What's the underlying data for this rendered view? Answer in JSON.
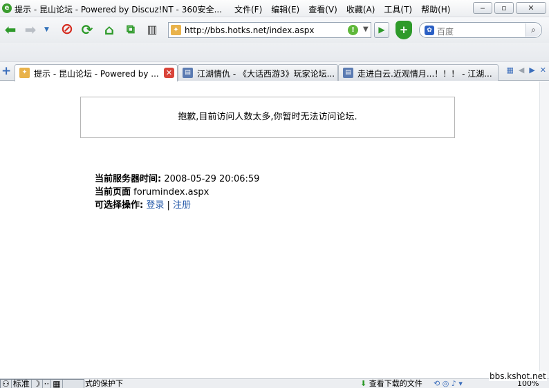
{
  "window": {
    "title": "提示 - 昆山论坛 - Powered by Discuz!NT - 360安全...",
    "menus": [
      "文件(F)",
      "编辑(E)",
      "查看(V)",
      "收藏(A)",
      "工具(T)",
      "帮助(H)"
    ],
    "controls": [
      "minimize-icon",
      "restore-icon",
      "close-icon"
    ]
  },
  "toolbar": {
    "url": "http://bbs.hotks.net/index.aspx",
    "search_placeholder": "百度"
  },
  "tabs": [
    {
      "label": "提示 - 昆山论坛 - Powered by ...",
      "active": true
    },
    {
      "label": "江湖情仇 - 《大话西游3》玩家论坛...",
      "active": false
    },
    {
      "label": "走进白云.近观情月...！！！ - 江湖...",
      "active": false
    }
  ],
  "page": {
    "message": "抱歉,目前访问人数太多,你暂时无法访问论坛.",
    "server_time_label": "当前服务器时间:",
    "server_time_value": "2008-05-29 20:06:59",
    "current_page_label": "当前页面",
    "current_page_value": "forumindex.aspx",
    "actions_label": "可选择操作:",
    "login_link": "登录",
    "separator": "|",
    "register_link": "注册"
  },
  "statusbar": {
    "ime_mode": "标准",
    "text": "式的保护下",
    "download": "查看下载的文件",
    "zoom": "100%"
  },
  "watermark": "bbs.kshot.net",
  "colors": {
    "link": "#2157a8",
    "accent_green": "#2e9a2a",
    "stop_red": "#d52a1e"
  }
}
